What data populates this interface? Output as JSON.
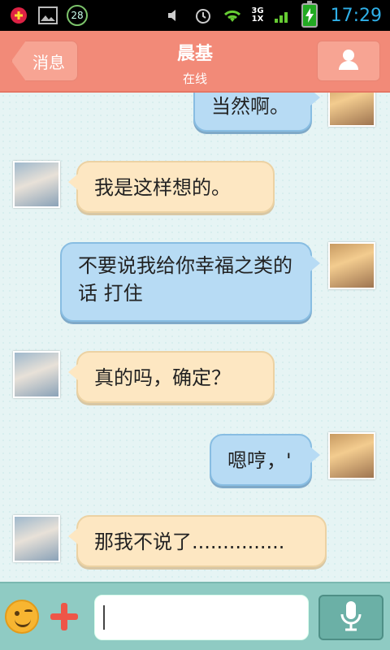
{
  "status_bar": {
    "notification_count": "28",
    "network_top": "3G",
    "network_bottom": "1X",
    "time": "17:29"
  },
  "header": {
    "back_label": "消息",
    "contact_name": "晨基",
    "contact_status": "在线"
  },
  "messages": [
    {
      "sender": "me",
      "text": "当然啊。"
    },
    {
      "sender": "friend",
      "text": "我是这样想的。"
    },
    {
      "sender": "me",
      "text": "不要说我给你幸福之类的话 打住"
    },
    {
      "sender": "friend",
      "text": "真的吗，确定？"
    },
    {
      "sender": "me",
      "text": "嗯哼，'"
    },
    {
      "sender": "friend",
      "text": "那我不说了..............."
    }
  ],
  "colors": {
    "header_bg": "#f28a78",
    "friend_bubble": "#fde7c2",
    "my_bubble": "#b7dbf4",
    "input_bar_bg": "#8fcbc3"
  },
  "icons": [
    "emoji-icon",
    "plus-icon",
    "microphone-icon",
    "person-icon"
  ]
}
